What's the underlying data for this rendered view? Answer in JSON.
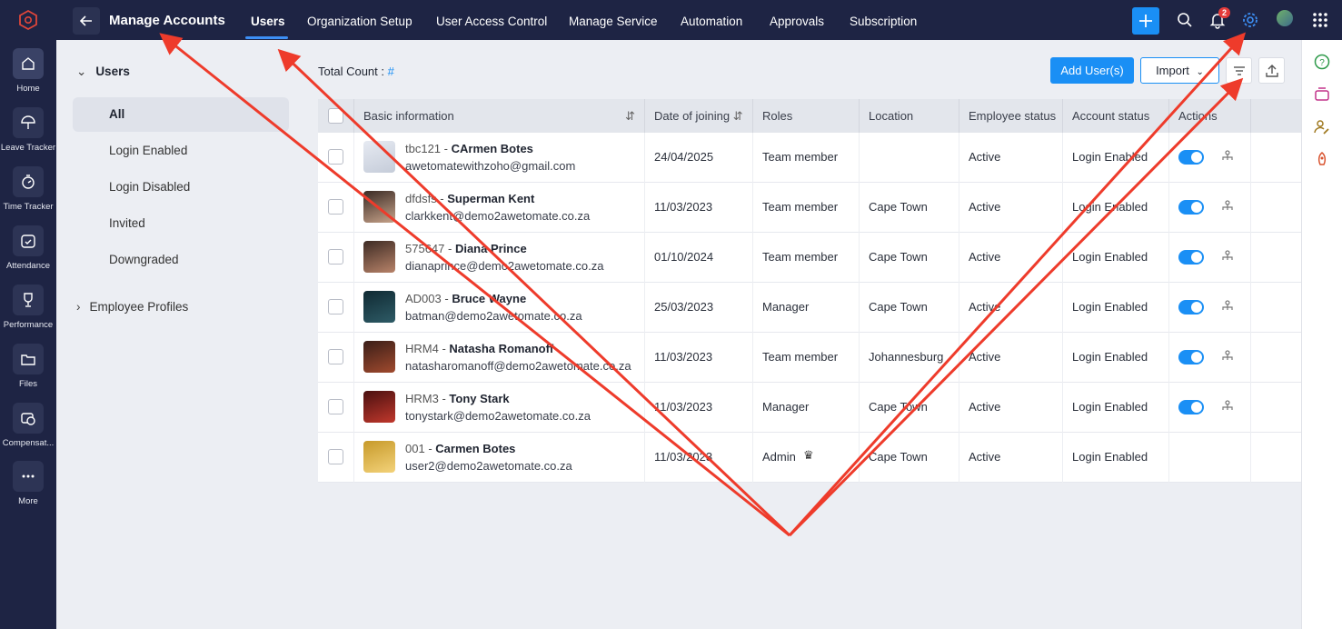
{
  "leftnav": {
    "items": [
      {
        "label": "Home",
        "icon": "home-icon"
      },
      {
        "label": "Leave Tracker",
        "icon": "umbrella-icon"
      },
      {
        "label": "Time Tracker",
        "icon": "stopwatch-icon"
      },
      {
        "label": "Attendance",
        "icon": "calendar-check-icon"
      },
      {
        "label": "Performance",
        "icon": "trophy-icon"
      },
      {
        "label": "Files",
        "icon": "folder-icon"
      },
      {
        "label": "Compensat...",
        "icon": "compensation-icon"
      },
      {
        "label": "More",
        "icon": "more-icon"
      }
    ]
  },
  "header": {
    "title": "Manage Accounts",
    "tabs": [
      {
        "label": "Users"
      },
      {
        "label": "Organization Setup"
      },
      {
        "label": "User Access Control"
      },
      {
        "label": "Manage Service"
      },
      {
        "label": "Automation"
      },
      {
        "label": "Approvals"
      },
      {
        "label": "Subscription"
      }
    ],
    "notification_count": "2"
  },
  "sidebar": {
    "section": "Users",
    "items": [
      {
        "label": "All"
      },
      {
        "label": "Login Enabled"
      },
      {
        "label": "Login Disabled"
      },
      {
        "label": "Invited"
      },
      {
        "label": "Downgraded"
      }
    ],
    "subsection": "Employee Profiles"
  },
  "main": {
    "total_label": "Total Count :",
    "total_value": "#",
    "add_button": "Add User(s)",
    "import_button": "Import"
  },
  "table": {
    "headers": [
      "Basic information",
      "Date of joining",
      "Roles",
      "Location",
      "Employee status",
      "Account status",
      "Actions"
    ],
    "rows": [
      {
        "id": "tbc121",
        "name": "CArmen Botes",
        "email": "awetomatewithzoho@gmail.com",
        "doj": "24/04/2025",
        "role": "Team member",
        "location": "",
        "emp_status": "Active",
        "acc_status": "Login Enabled"
      },
      {
        "id": "dfdsfs",
        "name": "Superman Kent",
        "email": "clarkkent@demo2awetomate.co.za",
        "doj": "11/03/2023",
        "role": "Team member",
        "location": "Cape Town",
        "emp_status": "Active",
        "acc_status": "Login Enabled"
      },
      {
        "id": "575647",
        "name": "Diana Prince",
        "email": "dianaprince@demo2awetomate.co.za",
        "doj": "01/10/2024",
        "role": "Team member",
        "location": "Cape Town",
        "emp_status": "Active",
        "acc_status": "Login Enabled"
      },
      {
        "id": "AD003",
        "name": "Bruce Wayne",
        "email": "batman@demo2awetomate.co.za",
        "doj": "25/03/2023",
        "role": "Manager",
        "location": "Cape Town",
        "emp_status": "Active",
        "acc_status": "Login Enabled"
      },
      {
        "id": "HRM4",
        "name": "Natasha Romanoff",
        "email": "natasharomanoff@demo2awetomate.co.za",
        "doj": "11/03/2023",
        "role": "Team member",
        "location": "Johannesburg",
        "emp_status": "Active",
        "acc_status": "Login Enabled"
      },
      {
        "id": "HRM3",
        "name": "Tony Stark",
        "email": "tonystark@demo2awetomate.co.za",
        "doj": "11/03/2023",
        "role": "Manager",
        "location": "Cape Town",
        "emp_status": "Active",
        "acc_status": "Login Enabled"
      },
      {
        "id": "001",
        "name": "Carmen Botes",
        "email": "user2@demo2awetomate.co.za",
        "doj": "11/03/2023",
        "role": "Admin",
        "location": "Cape Town",
        "emp_status": "Active",
        "acc_status": "Login Enabled"
      }
    ]
  },
  "colors": {
    "nav_bg": "#1e2444",
    "accent": "#1a8ff5",
    "annotation_arrow": "#ee3b2b"
  }
}
